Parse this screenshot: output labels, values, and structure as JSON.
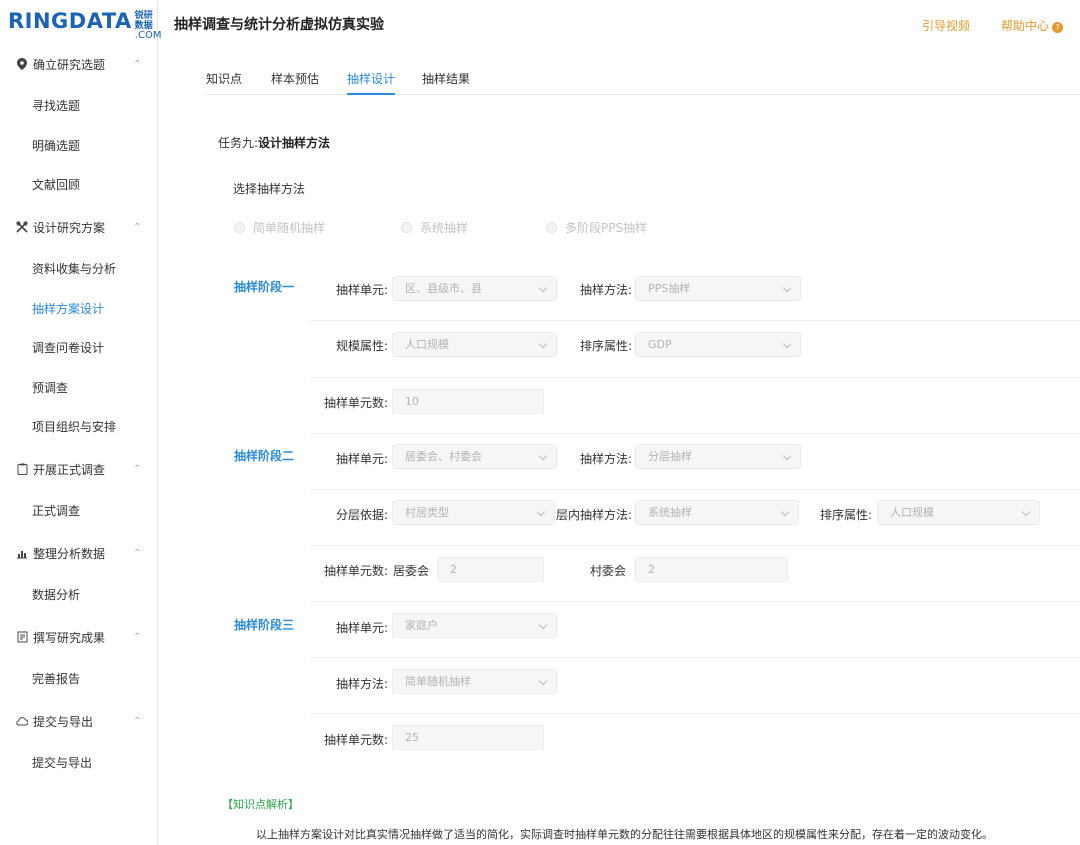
{
  "logo": {
    "main": "RINGDATA",
    "cn": "锐研数据",
    "com": ".COM"
  },
  "header": {
    "title": "抽样调查与统计分析虚拟仿真实验",
    "guide_video": "引导视频",
    "help_center": "帮助中心",
    "help_icon_glyph": "?"
  },
  "sidebar": {
    "sections": [
      {
        "label": "确立研究选题",
        "icon": "location-pin-icon",
        "glyph": "⬤",
        "items": [
          "寻找选题",
          "明确选题",
          "文献回顾"
        ]
      },
      {
        "label": "设计研究方案",
        "icon": "tools-icon",
        "glyph": "✂",
        "items": [
          "资料收集与分析",
          "抽样方案设计",
          "调查问卷设计",
          "预调查",
          "项目组织与安排"
        ]
      },
      {
        "label": "开展正式调查",
        "icon": "clipboard-icon",
        "glyph": "▢",
        "items": [
          "正式调查"
        ]
      },
      {
        "label": "整理分析数据",
        "icon": "chart-icon",
        "glyph": "▥",
        "items": [
          "数据分析"
        ]
      },
      {
        "label": "撰写研究成果",
        "icon": "document-icon",
        "glyph": "▤",
        "items": [
          "完善报告"
        ]
      },
      {
        "label": "提交与导出",
        "icon": "cloud-icon",
        "glyph": "☁",
        "items": [
          "提交与导出"
        ]
      }
    ],
    "caret_glyph": "⌃",
    "active_item": "抽样方案设计"
  },
  "tabs": [
    "知识点",
    "样本预估",
    "抽样设计",
    "抽样结果"
  ],
  "active_tab": "抽样设计",
  "task": {
    "prefix": "任务九:",
    "title": "设计抽样方法"
  },
  "method": {
    "label": "选择抽样方法",
    "options": [
      "简单随机抽样",
      "系统抽样",
      "多阶段PPS抽样"
    ]
  },
  "stage1": {
    "label": "抽样阶段一",
    "unit_label": "抽样单元:",
    "unit_value": "区、县级市、县",
    "method_label": "抽样方法:",
    "method_value": "PPS抽样",
    "scale_label": "规模属性:",
    "scale_value": "人口规模",
    "sort_label": "排序属性:",
    "sort_value": "GDP",
    "count_label": "抽样单元数:",
    "count_value": "10"
  },
  "stage2": {
    "label": "抽样阶段二",
    "unit_label": "抽样单元:",
    "unit_value": "居委会、村委会",
    "method_label": "抽样方法:",
    "method_value": "分层抽样",
    "strat_label": "分层依据:",
    "strat_value": "村居类型",
    "inner_label": "层内抽样方法:",
    "inner_value": "系统抽样",
    "sort_label": "排序属性:",
    "sort_value": "人口规模",
    "count_label": "抽样单元数:",
    "urban_label": "居委会",
    "urban_value": "2",
    "rural_label": "村委会",
    "rural_value": "2"
  },
  "stage3": {
    "label": "抽样阶段三",
    "unit_label": "抽样单元:",
    "unit_value": "家庭户",
    "method_label": "抽样方法:",
    "method_value": "简单随机抽样",
    "count_label": "抽样单元数:",
    "count_value": "25"
  },
  "knowledge": {
    "title": "【知识点解析】",
    "text": "以上抽样方案设计对比真实情况抽样做了适当的简化，实际调查时抽样单元数的分配往往需要根据具体地区的规模属性来分配，存在着一定的波动变化。"
  }
}
